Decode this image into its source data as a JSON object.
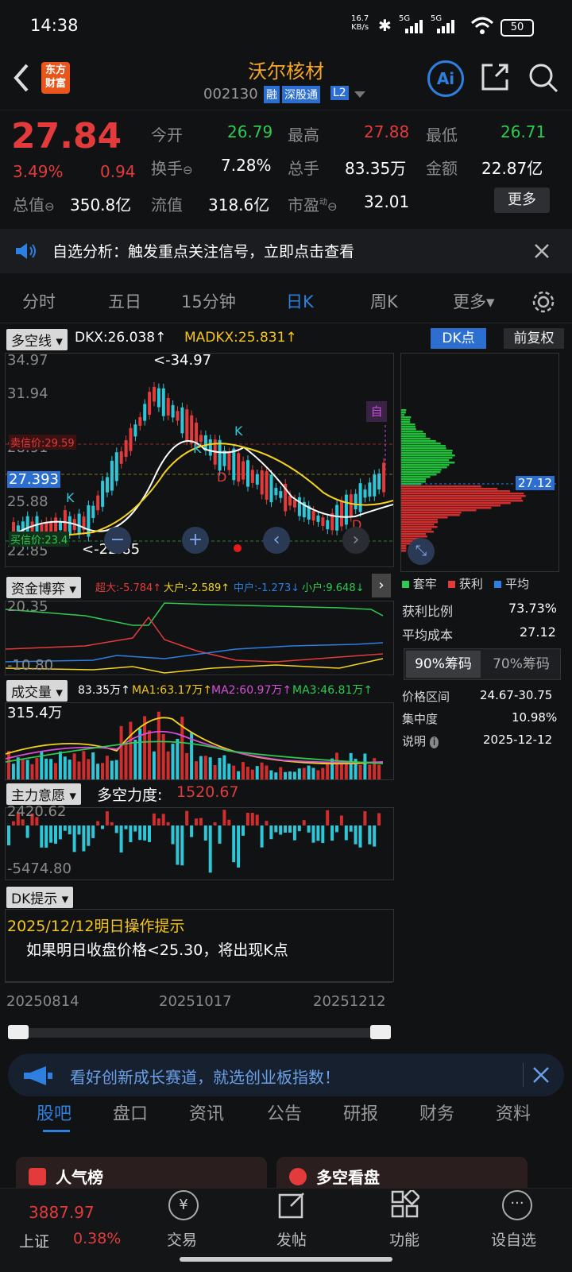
{
  "status": {
    "time": "14:38",
    "net_speed": "16.7",
    "net_unit": "KB/s",
    "sig1": "5G",
    "sig2": "5G",
    "battery": "50"
  },
  "header": {
    "logo_line1": "东方",
    "logo_line2": "财富",
    "name": "沃尔核材",
    "code": "002130",
    "badges": [
      "融",
      "深股通",
      "L2"
    ],
    "ai": "Ai"
  },
  "quote": {
    "price": "27.84",
    "pct": "3.49%",
    "chg": "0.94",
    "open_label": "今开",
    "open": "26.79",
    "high_label": "最高",
    "high": "27.88",
    "low_label": "最低",
    "low": "26.71",
    "turnover_label": "换手",
    "turnover": "7.28%",
    "vol_label": "总手",
    "vol": "83.35万",
    "amt_label": "金额",
    "amt": "22.87亿",
    "mcap_label": "总值",
    "mcap": "350.8亿",
    "float_label": "流值",
    "float": "318.6亿",
    "pe_label": "市盈",
    "pe_sup": "动",
    "pe": "32.01",
    "more": "更多"
  },
  "banner": {
    "text": "自选分析：触发重点关注信号，立即点击查看"
  },
  "tabs": [
    "分时",
    "五日",
    "15分钟",
    "日K",
    "周K",
    "更多▾"
  ],
  "active_tab": 3,
  "kline": {
    "indicator_dd": "多空线",
    "dkx": "DKX:26.038↑",
    "madkx": "MADKX:25.831↑",
    "dk_btn": "DK点",
    "fq_btn": "前复权",
    "y1": "34.97",
    "y2": "31.94",
    "y3": "28.91",
    "y4": "25.88",
    "y5": "22.85",
    "price_tag": "27.393",
    "hi_mark": "<-34.97",
    "lo_mark": "<-22.85",
    "sell_label": "卖信价:29.59",
    "buy_label": "买信价:23.4",
    "zi": "自"
  },
  "chips": {
    "price_tag": "27.12",
    "legend": [
      "套牢",
      "获利",
      "平均"
    ],
    "profit_label": "获利比例",
    "profit": "73.73%",
    "avg_label": "平均成本",
    "avg": "27.12",
    "tab90": "90%筹码",
    "tab70": "70%筹码",
    "range_label": "价格区间",
    "range": "24.67-30.75",
    "conc_label": "集中度",
    "conc": "10.98%",
    "note_label": "说明",
    "note_date": "2025-12-12"
  },
  "fund": {
    "dd": "资金博弈",
    "super": "超大:-5.784↑",
    "big": "大户:-2.589↑",
    "mid": "中户:-1.273↓",
    "small": "小户:9.648↓",
    "top": "20.35",
    "bottom": "-10.80"
  },
  "volume": {
    "dd": "成交量",
    "v": "83.35万↑",
    "ma1": "MA1:63.17万↑",
    "ma2": "MA2:60.97万↑",
    "ma3": "MA3:46.81万↑",
    "top": "315.4万"
  },
  "force": {
    "dd": "主力意愿",
    "label": "多空力度:",
    "value": "1520.67",
    "top": "2420.62",
    "bottom": "-5474.80"
  },
  "dk": {
    "dd": "DK提示",
    "title": "2025/12/12明日操作提示",
    "text": "如果明日收盘价格<25.30，将出现K点"
  },
  "dates": [
    "20250814",
    "20251017",
    "20251212"
  ],
  "ad": {
    "text": "看好创新成长赛道，就选创业板指数！"
  },
  "nav": [
    "股吧",
    "盘口",
    "资讯",
    "公告",
    "研报",
    "财务",
    "资料"
  ],
  "cards": [
    "人气榜",
    "多空看盘"
  ],
  "bottom": {
    "index_val": "3887.97",
    "index_name": "上证",
    "index_pct": "0.38%",
    "items": [
      "交易",
      "发帖",
      "功能",
      "设自选"
    ]
  }
}
